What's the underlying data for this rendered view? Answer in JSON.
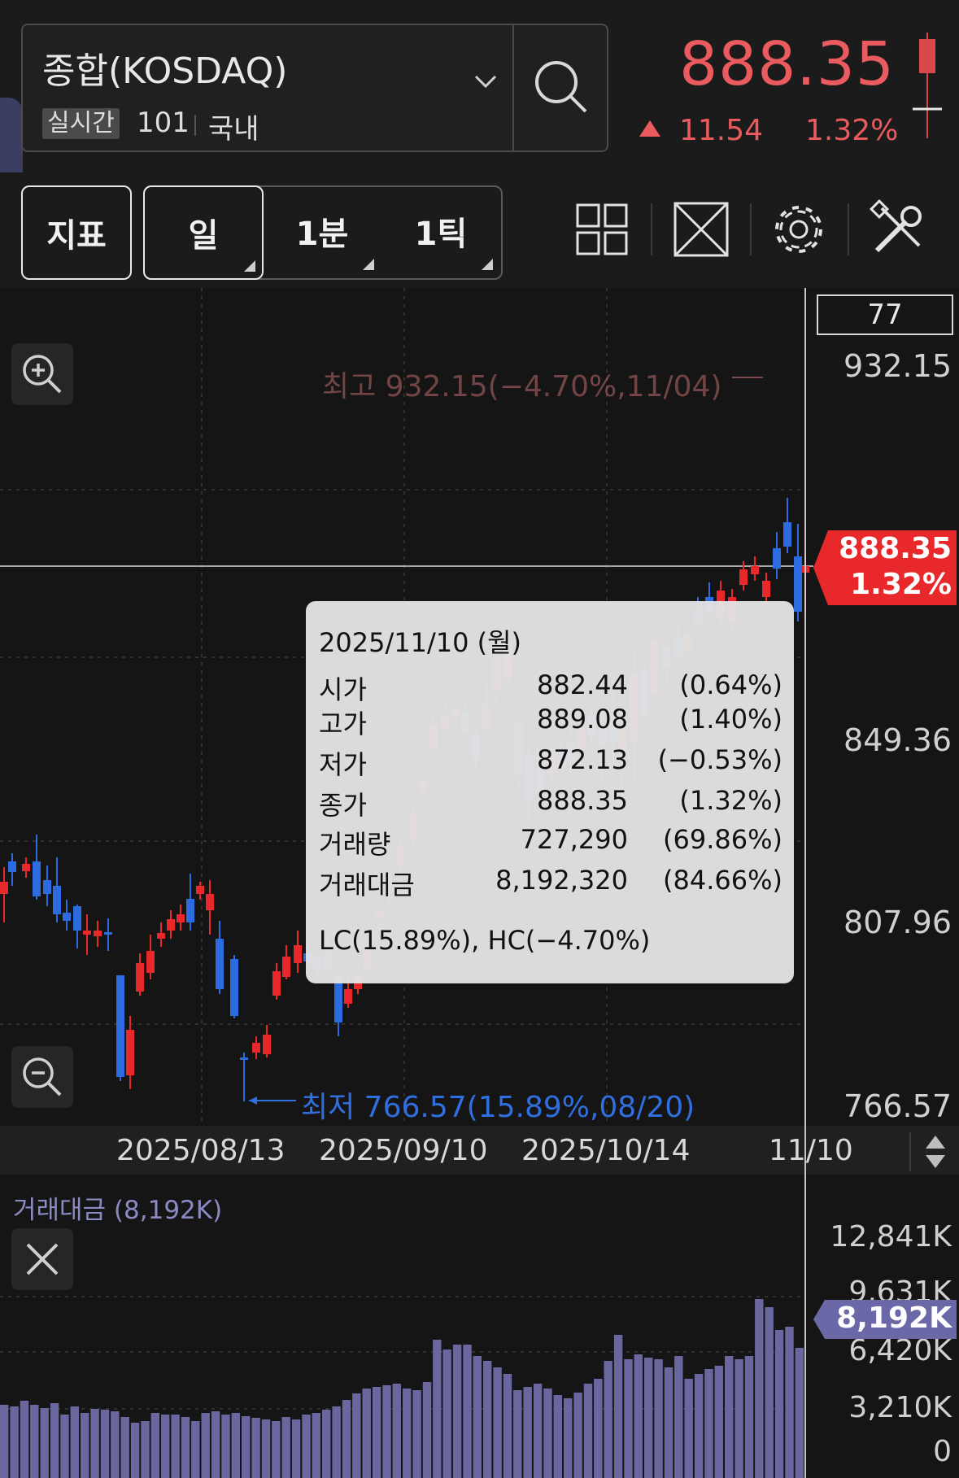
{
  "header": {
    "symbol_name": "종합(KOSDAQ)",
    "realtime_tag": "실시간",
    "code": "101",
    "market": "국내",
    "price": "888.35",
    "change_abs": "11.54",
    "change_pct": "1.32%",
    "up_color": "#e95b5e"
  },
  "toolbar": {
    "indicator_label": "지표",
    "period_day": "일",
    "period_1min": "1분",
    "period_1tick": "1틱",
    "icons": [
      "grid-layout-icon",
      "expand-icon",
      "gear-icon",
      "tools-icon"
    ]
  },
  "chart": {
    "count": "77",
    "y_labels": [
      "932.15",
      "849.36",
      "807.96",
      "766.57"
    ],
    "x_labels": [
      "2025/08/13",
      "2025/09/10",
      "2025/10/14",
      "11/10"
    ],
    "high_label": "최고 932.15(−4.70%,11/04)",
    "low_label": "최저 766.57(15.89%,08/20)",
    "price_tag": "888.35",
    "price_tag_pct": "1.32%",
    "up_color": "#e8282b",
    "down_color": "#2c6ce0"
  },
  "tooltip": {
    "date": "2025/11/10 (월)",
    "rows": [
      {
        "key": "시가",
        "value": "882.44",
        "pct": "(0.64%)"
      },
      {
        "key": "고가",
        "value": "889.08",
        "pct": "(1.40%)"
      },
      {
        "key": "저가",
        "value": "872.13",
        "pct": "(−0.53%)"
      },
      {
        "key": "종가",
        "value": "888.35",
        "pct": "(1.32%)"
      },
      {
        "key": "거래량",
        "value": "727,290",
        "pct": "(69.86%)"
      },
      {
        "key": "거래대금",
        "value": "8,192,320",
        "pct": "(84.66%)"
      }
    ],
    "lc_hc": "LC(15.89%), HC(−4.70%)"
  },
  "volume": {
    "title": "거래대금 (8,192K)",
    "y_labels": [
      "12,841K",
      "9,631K",
      "6,420K",
      "3,210K",
      "0"
    ],
    "tag": "8,192K",
    "bar_color": "#6a679f"
  }
}
